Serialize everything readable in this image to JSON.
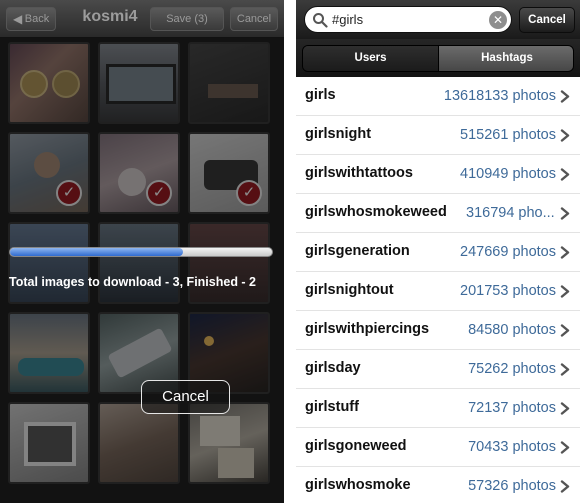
{
  "left_screen": {
    "nav": {
      "back_label": "Back",
      "title": "kosmi4",
      "save_label": "Save (3)",
      "cancel_label": "Cancel"
    },
    "progress": {
      "fraction": 0.66,
      "text": "Total images to download - 3, Finished - 2"
    },
    "overlay_cancel_label": "Cancel"
  },
  "right_screen": {
    "search": {
      "query": "#girls",
      "cancel_label": "Cancel"
    },
    "tabs": [
      {
        "label": "Users",
        "selected": false
      },
      {
        "label": "Hashtags",
        "selected": true
      }
    ],
    "results": [
      {
        "tag": "girls",
        "count": "13618133 photos"
      },
      {
        "tag": "girlsnight",
        "count": "515261 photos"
      },
      {
        "tag": "girlswithtattoos",
        "count": "410949 photos"
      },
      {
        "tag": "girlswhosmokeweed",
        "count": "316794 pho..."
      },
      {
        "tag": "girlsgeneration",
        "count": "247669 photos"
      },
      {
        "tag": "girlsnightout",
        "count": "201753 photos"
      },
      {
        "tag": "girlswithpiercings",
        "count": "84580 photos"
      },
      {
        "tag": "girlsday",
        "count": "75262 photos"
      },
      {
        "tag": "girlstuff",
        "count": "72137 photos"
      },
      {
        "tag": "girlsgoneweed",
        "count": "70433 photos"
      },
      {
        "tag": "girlswhosmoke",
        "count": "57326 photos"
      }
    ]
  }
}
